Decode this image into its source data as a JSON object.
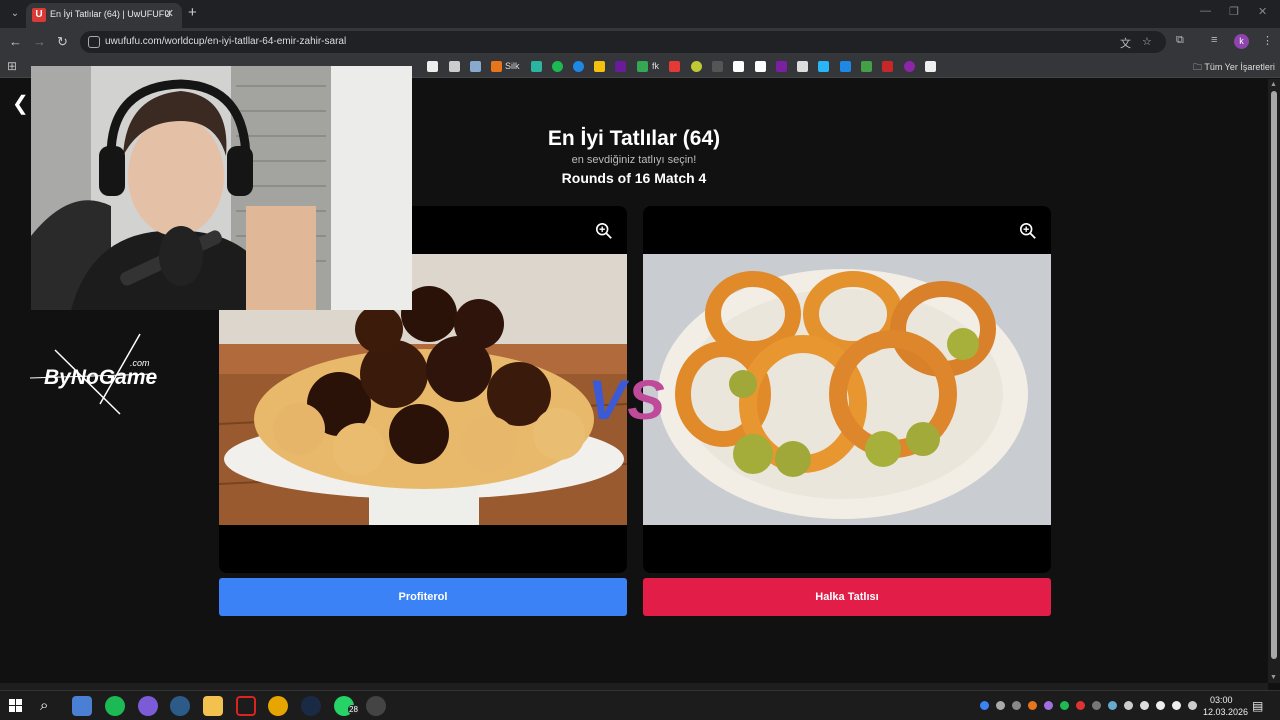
{
  "browser": {
    "tab_title": "En İyi Tatlılar (64) | UwUFUFU",
    "tab_favicon_letter": "U",
    "url": "uwufufu.com/worldcup/en-iyi-tatllar-64-emir-zahir-saral",
    "bookmark_silk": "Silk",
    "bookmark_fk": "fk",
    "bookmarks_folder": "Tüm Yer İşaretleri",
    "profile_initial": "k"
  },
  "page": {
    "title": "En İyi Tatlılar (64)",
    "subtitle": "en sevdiğiniz tatlıyı seçin!",
    "round": "Rounds of 16 Match 4",
    "vs_v": "V",
    "vs_s": "S",
    "left_choice": "Profiterol",
    "right_choice": "Halka Tatlısı",
    "left_color": "#3b82f6",
    "right_color": "#e11d48"
  },
  "overlay": {
    "watermark": "ByNoGame",
    "watermark_suffix": ".com"
  },
  "taskbar": {
    "time": "03:00",
    "date": "12.03.2026",
    "whatsapp_badge": "28"
  }
}
